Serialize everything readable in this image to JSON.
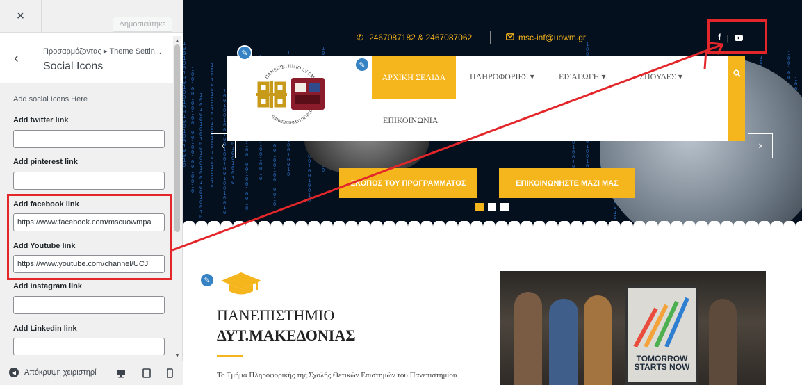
{
  "customizer": {
    "close_icon": "×",
    "publish_label": "Δημοσιεύτηκε",
    "back_icon": "‹",
    "breadcrumb": "Προσαρμόζοντας ▸ Theme Settin...",
    "section_title": "Social Icons",
    "description": "Add social Icons Here",
    "fields": [
      {
        "label": "Add twitter link",
        "value": ""
      },
      {
        "label": "Add pinterest link",
        "value": ""
      },
      {
        "label": "Add facebook link",
        "value": "https://www.facebook.com/mscuowmpa"
      },
      {
        "label": "Add Youtube link",
        "value": "https://www.youtube.com/channel/UCJ"
      },
      {
        "label": "Add Instagram link",
        "value": ""
      },
      {
        "label": "Add Linkedin link",
        "value": ""
      }
    ],
    "collapse_label": "Απόκρυψη χειριστηρί",
    "devices": [
      "desktop-icon",
      "tablet-icon",
      "mobile-icon"
    ]
  },
  "site": {
    "phone": "2467087182 & 2467087062",
    "email": "msc-inf@uowm.gr",
    "social": [
      "facebook-icon",
      "youtube-icon"
    ],
    "social_sep": "|",
    "nav": {
      "home": "ΑΡΧΙΚΗ ΣΕΛΙΔΑ",
      "items": [
        "ΠΛΗΡΟΦΟΡΙΕΣ",
        "ΕΙΣΑΓΩΓΗ",
        "ΣΠΟΥΔΕΣ"
      ],
      "contact": "ΕΠΙΚΟΙΝΩΝΙΑ"
    },
    "hero_buttons": [
      "ΣΚΟΠΟΣ ΤΟΥ ΠΡΟΓΡΑΜΜΑΤΟΣ",
      "ΕΠΙΚΟΙΝΩΝΗΣΤΕ ΜΑΖΙ ΜΑΣ"
    ],
    "slider_dots": 3,
    "logo_text_top": "ΠΑΝΕΠΙΣΤΗΜΙΟ ΔΥΤ.ΜΑΚΕΔΟΝΙΑΣ",
    "logo_text_bottom": "ΠΑΝΕΠΙΣΤΗΜΙΟ ΠΕΙΡΑΙΑ",
    "content": {
      "title_line1": "ΠΑΝΕΠΙΣΤΗΜΙΟ",
      "title_line2": "ΔΥΤ.ΜΑΚΕΔΟΝΙΑΣ",
      "text": "Το Τμήμα Πληροφορικής της Σχολής Θετικών Επιστημών του Πανεπιστημίου",
      "board_line1": "TOMORROW",
      "board_line2": "STARTS NOW"
    }
  },
  "colors": {
    "accent": "#f5b51c",
    "annotation": "#e3262a",
    "wp_blue": "#3582c4"
  }
}
